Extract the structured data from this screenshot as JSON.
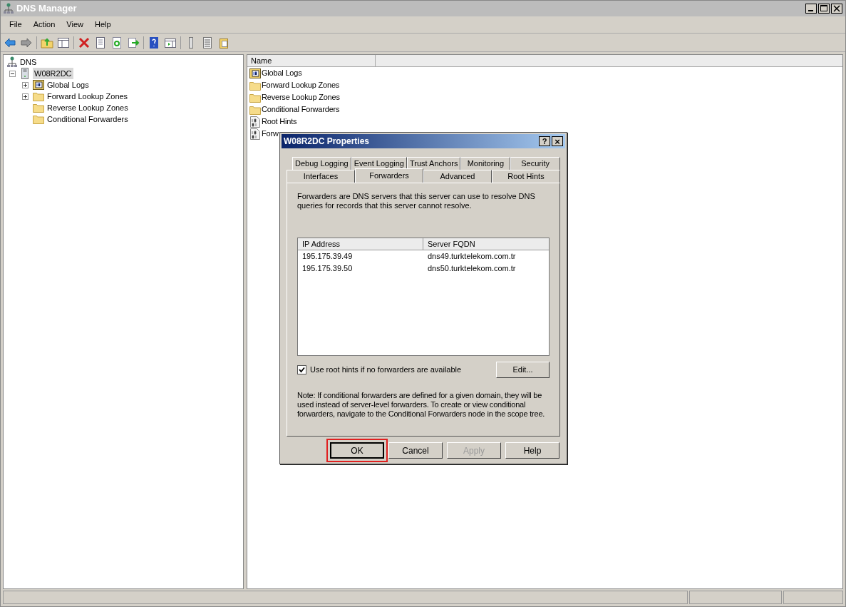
{
  "window": {
    "title": "DNS Manager"
  },
  "menu": [
    "File",
    "Action",
    "View",
    "Help"
  ],
  "tree": {
    "label": "DNS",
    "children": [
      {
        "label": "W08R2DC",
        "expanded": true,
        "selected": true,
        "kind": "server",
        "children": [
          {
            "label": "Global Logs",
            "kind": "log",
            "expandable": true
          },
          {
            "label": "Forward Lookup Zones",
            "kind": "folder",
            "expandable": true
          },
          {
            "label": "Reverse Lookup Zones",
            "kind": "folder",
            "expandable": false
          },
          {
            "label": "Conditional Forwarders",
            "kind": "folder",
            "expandable": false
          }
        ]
      }
    ]
  },
  "list": {
    "columns": [
      "Name"
    ],
    "items": [
      {
        "label": "Global Logs",
        "kind": "log"
      },
      {
        "label": "Forward Lookup Zones",
        "kind": "folder"
      },
      {
        "label": "Reverse Lookup Zones",
        "kind": "folder"
      },
      {
        "label": "Conditional Forwarders",
        "kind": "folder"
      },
      {
        "label": "Root Hints",
        "kind": "binary"
      },
      {
        "label": "Forw",
        "kind": "binary"
      }
    ]
  },
  "dialog": {
    "title": "W08R2DC Properties",
    "help_button": "?",
    "close_button": "×",
    "tab_rows": [
      [
        {
          "label": "Debug Logging",
          "selected": false
        },
        {
          "label": "Event Logging",
          "selected": false
        },
        {
          "label": "Trust Anchors",
          "selected": false
        },
        {
          "label": "Monitoring",
          "selected": false
        },
        {
          "label": "Security",
          "selected": false
        }
      ],
      [
        {
          "label": "Interfaces",
          "selected": false
        },
        {
          "label": "Forwarders",
          "selected": true
        },
        {
          "label": "Advanced",
          "selected": false
        },
        {
          "label": "Root Hints",
          "selected": false
        }
      ]
    ],
    "description": "Forwarders are DNS servers that this server can use to resolve DNS queries for records that this server cannot resolve.",
    "table": {
      "columns": [
        "IP Address",
        "Server FQDN"
      ],
      "rows": [
        [
          "195.175.39.49",
          "dns49.turktelekom.com.tr"
        ],
        [
          "195.175.39.50",
          "dns50.turktelekom.com.tr"
        ]
      ]
    },
    "checkbox": {
      "label": "Use root hints if no forwarders are available",
      "checked": true
    },
    "edit_button": "Edit...",
    "note": "Note: If conditional forwarders are defined for a given domain, they will be used instead of server-level forwarders.  To create or view conditional forwarders, navigate to the Conditional Forwarders node in the scope tree.",
    "buttons": [
      {
        "label": "OK",
        "disabled": false,
        "highlighted": true
      },
      {
        "label": "Cancel",
        "disabled": false,
        "highlighted": false
      },
      {
        "label": "Apply",
        "disabled": true,
        "highlighted": false
      },
      {
        "label": "Help",
        "disabled": false,
        "highlighted": false
      }
    ]
  }
}
